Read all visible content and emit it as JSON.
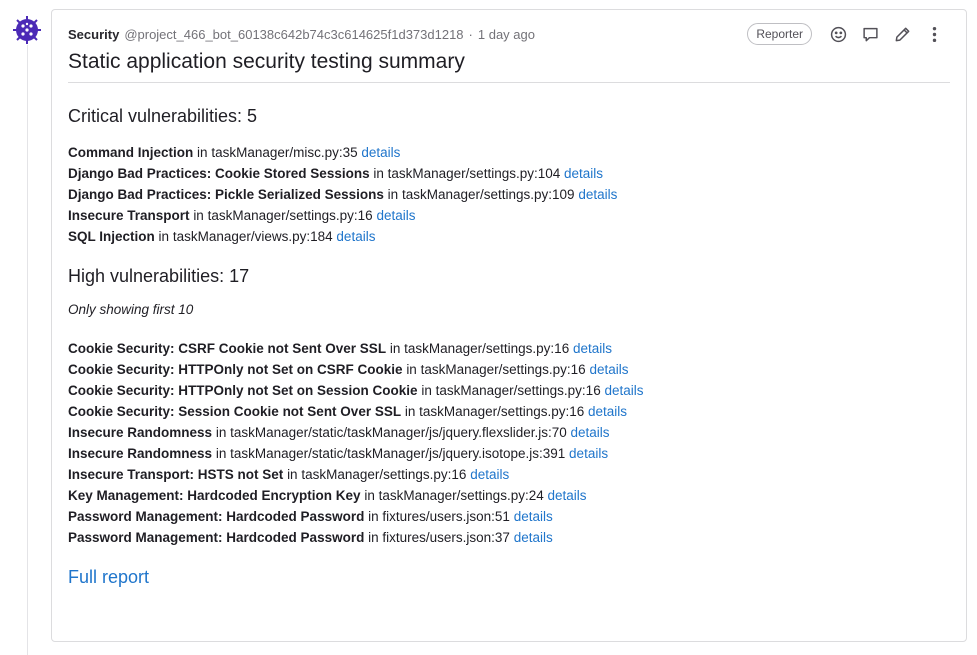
{
  "note": {
    "author": "Security",
    "username": "@project_466_bot_60138c642b74c3c614625f1d373d1218",
    "separator": "·",
    "time": "1 day ago",
    "role_badge": "Reporter",
    "title": "Static application security testing summary"
  },
  "critical": {
    "heading": "Critical vulnerabilities: 5",
    "items": [
      {
        "name": "Command Injection",
        "in": "in",
        "location": "taskManager/misc.py:35",
        "link": "details"
      },
      {
        "name": "Django Bad Practices: Cookie Stored Sessions",
        "in": "in",
        "location": "taskManager/settings.py:104",
        "link": "details"
      },
      {
        "name": "Django Bad Practices: Pickle Serialized Sessions",
        "in": "in",
        "location": "taskManager/settings.py:109",
        "link": "details"
      },
      {
        "name": "Insecure Transport",
        "in": "in",
        "location": "taskManager/settings.py:16",
        "link": "details"
      },
      {
        "name": "SQL Injection",
        "in": "in",
        "location": "taskManager/views.py:184",
        "link": "details"
      }
    ]
  },
  "high": {
    "heading": "High vulnerabilities: 17",
    "note": "Only showing first 10",
    "items": [
      {
        "name": "Cookie Security: CSRF Cookie not Sent Over SSL",
        "in": "in",
        "location": "taskManager/settings.py:16",
        "link": "details"
      },
      {
        "name": "Cookie Security: HTTPOnly not Set on CSRF Cookie",
        "in": "in",
        "location": "taskManager/settings.py:16",
        "link": "details"
      },
      {
        "name": "Cookie Security: HTTPOnly not Set on Session Cookie",
        "in": "in",
        "location": "taskManager/settings.py:16",
        "link": "details"
      },
      {
        "name": "Cookie Security: Session Cookie not Sent Over SSL",
        "in": "in",
        "location": "taskManager/settings.py:16",
        "link": "details"
      },
      {
        "name": "Insecure Randomness",
        "in": "in",
        "location": "taskManager/static/taskManager/js/jquery.flexslider.js:70",
        "link": "details"
      },
      {
        "name": "Insecure Randomness",
        "in": "in",
        "location": "taskManager/static/taskManager/js/jquery.isotope.js:391",
        "link": "details"
      },
      {
        "name": "Insecure Transport: HSTS not Set",
        "in": "in",
        "location": "taskManager/settings.py:16",
        "link": "details"
      },
      {
        "name": "Key Management: Hardcoded Encryption Key",
        "in": "in",
        "location": "taskManager/settings.py:24",
        "link": "details"
      },
      {
        "name": "Password Management: Hardcoded Password",
        "in": "in",
        "location": "fixtures/users.json:51",
        "link": "details"
      },
      {
        "name": "Password Management: Hardcoded Password",
        "in": "in",
        "location": "fixtures/users.json:37",
        "link": "details"
      }
    ]
  },
  "full_report_link": "Full report",
  "icons": {
    "avatar": "bug-avatar-icon",
    "emoji": "smiley-icon",
    "reply": "comment-icon",
    "edit": "pencil-icon",
    "more": "kebab-menu-icon"
  },
  "colors": {
    "link": "#1f75cb",
    "avatar": "#4b2ab6"
  }
}
